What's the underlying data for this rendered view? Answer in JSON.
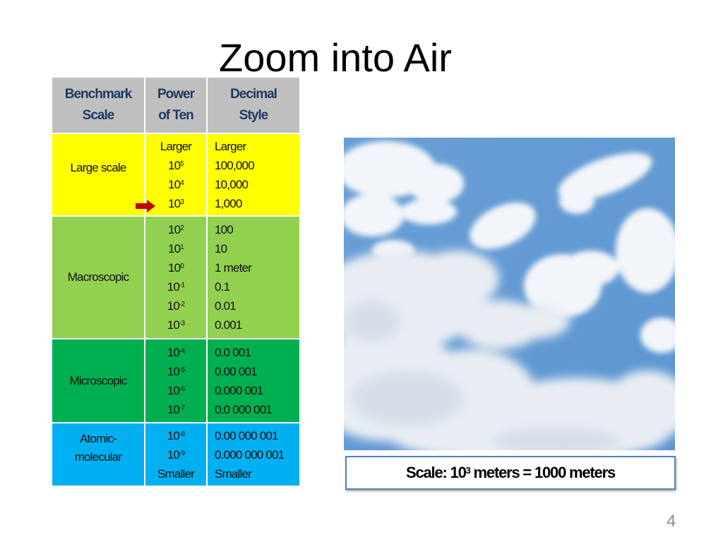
{
  "slide": {
    "title": "Zoom into Air",
    "page_number": "4"
  },
  "table": {
    "headers": [
      {
        "line1": "Benchmark",
        "line2": "Scale"
      },
      {
        "line1": "Power",
        "line2": "of Ten"
      },
      {
        "line1": "Decimal",
        "line2": "Style"
      }
    ],
    "rows": [
      {
        "scale": "Large scale",
        "color": "#ffff00",
        "powers": [
          {
            "text": "Larger",
            "exp": ""
          },
          {
            "text": "10",
            "exp": "5"
          },
          {
            "text": "10",
            "exp": "4"
          },
          {
            "text": "10",
            "exp": "3"
          }
        ],
        "decimals": [
          "Larger",
          "100,000",
          "10,000",
          "1,000"
        ]
      },
      {
        "scale": "Macroscopic",
        "color": "#92d050",
        "powers": [
          {
            "text": "10",
            "exp": "2"
          },
          {
            "text": "10",
            "exp": "1"
          },
          {
            "text": "10",
            "exp": "0"
          },
          {
            "text": "10",
            "exp": "-1"
          },
          {
            "text": "10",
            "exp": "-2"
          },
          {
            "text": "10",
            "exp": "-3"
          }
        ],
        "decimals": [
          "100",
          "10",
          "1 meter",
          "0.1",
          "0.01",
          "0.001"
        ]
      },
      {
        "scale": "Microscopic",
        "color": "#00b050",
        "powers": [
          {
            "text": "10",
            "exp": "-4"
          },
          {
            "text": "10",
            "exp": "-5"
          },
          {
            "text": "10",
            "exp": "-6"
          },
          {
            "text": "10",
            "exp": "-7"
          }
        ],
        "decimals": [
          "0.0 001",
          "0.00 001",
          "0.000 001",
          "0.0 000 001"
        ]
      },
      {
        "scale": "Atomic-molecular",
        "scale_lines": [
          "Atomic-",
          "molecular"
        ],
        "color": "#00b0f0",
        "powers": [
          {
            "text": "10",
            "exp": "-8"
          },
          {
            "text": "10",
            "exp": "-9"
          },
          {
            "text": "Smaller",
            "exp": ""
          }
        ],
        "decimals": [
          "0.00 000 001",
          "0.000 000 001",
          "Smaller"
        ]
      }
    ],
    "current_marker": {
      "icon": "right-arrow-icon",
      "row": "Large scale",
      "power": "10^3",
      "color": "#c00000"
    }
  },
  "image": {
    "subject": "blue sky with white clouds"
  },
  "caption": {
    "prefix": "Scale: 10",
    "exp": "3",
    "suffix": " meters = 1000 meters"
  }
}
